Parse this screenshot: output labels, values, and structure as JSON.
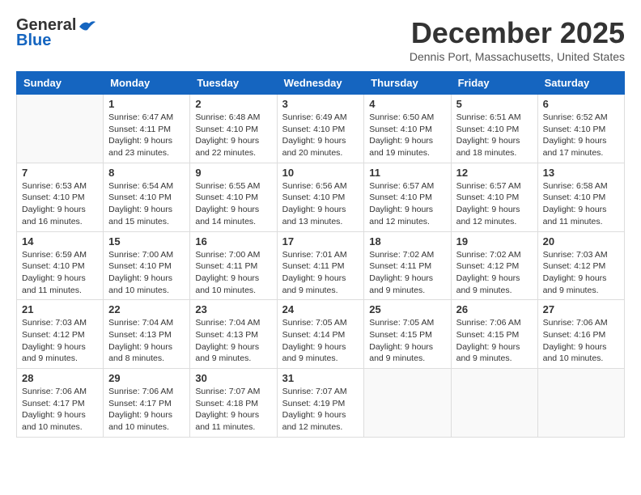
{
  "header": {
    "logo_general": "General",
    "logo_blue": "Blue",
    "month_title": "December 2025",
    "location": "Dennis Port, Massachusetts, United States"
  },
  "days_of_week": [
    "Sunday",
    "Monday",
    "Tuesday",
    "Wednesday",
    "Thursday",
    "Friday",
    "Saturday"
  ],
  "weeks": [
    [
      {
        "day": "",
        "sunrise": "",
        "sunset": "",
        "daylight": ""
      },
      {
        "day": "1",
        "sunrise": "Sunrise: 6:47 AM",
        "sunset": "Sunset: 4:11 PM",
        "daylight": "Daylight: 9 hours and 23 minutes."
      },
      {
        "day": "2",
        "sunrise": "Sunrise: 6:48 AM",
        "sunset": "Sunset: 4:10 PM",
        "daylight": "Daylight: 9 hours and 22 minutes."
      },
      {
        "day": "3",
        "sunrise": "Sunrise: 6:49 AM",
        "sunset": "Sunset: 4:10 PM",
        "daylight": "Daylight: 9 hours and 20 minutes."
      },
      {
        "day": "4",
        "sunrise": "Sunrise: 6:50 AM",
        "sunset": "Sunset: 4:10 PM",
        "daylight": "Daylight: 9 hours and 19 minutes."
      },
      {
        "day": "5",
        "sunrise": "Sunrise: 6:51 AM",
        "sunset": "Sunset: 4:10 PM",
        "daylight": "Daylight: 9 hours and 18 minutes."
      },
      {
        "day": "6",
        "sunrise": "Sunrise: 6:52 AM",
        "sunset": "Sunset: 4:10 PM",
        "daylight": "Daylight: 9 hours and 17 minutes."
      }
    ],
    [
      {
        "day": "7",
        "sunrise": "Sunrise: 6:53 AM",
        "sunset": "Sunset: 4:10 PM",
        "daylight": "Daylight: 9 hours and 16 minutes."
      },
      {
        "day": "8",
        "sunrise": "Sunrise: 6:54 AM",
        "sunset": "Sunset: 4:10 PM",
        "daylight": "Daylight: 9 hours and 15 minutes."
      },
      {
        "day": "9",
        "sunrise": "Sunrise: 6:55 AM",
        "sunset": "Sunset: 4:10 PM",
        "daylight": "Daylight: 9 hours and 14 minutes."
      },
      {
        "day": "10",
        "sunrise": "Sunrise: 6:56 AM",
        "sunset": "Sunset: 4:10 PM",
        "daylight": "Daylight: 9 hours and 13 minutes."
      },
      {
        "day": "11",
        "sunrise": "Sunrise: 6:57 AM",
        "sunset": "Sunset: 4:10 PM",
        "daylight": "Daylight: 9 hours and 12 minutes."
      },
      {
        "day": "12",
        "sunrise": "Sunrise: 6:57 AM",
        "sunset": "Sunset: 4:10 PM",
        "daylight": "Daylight: 9 hours and 12 minutes."
      },
      {
        "day": "13",
        "sunrise": "Sunrise: 6:58 AM",
        "sunset": "Sunset: 4:10 PM",
        "daylight": "Daylight: 9 hours and 11 minutes."
      }
    ],
    [
      {
        "day": "14",
        "sunrise": "Sunrise: 6:59 AM",
        "sunset": "Sunset: 4:10 PM",
        "daylight": "Daylight: 9 hours and 11 minutes."
      },
      {
        "day": "15",
        "sunrise": "Sunrise: 7:00 AM",
        "sunset": "Sunset: 4:10 PM",
        "daylight": "Daylight: 9 hours and 10 minutes."
      },
      {
        "day": "16",
        "sunrise": "Sunrise: 7:00 AM",
        "sunset": "Sunset: 4:11 PM",
        "daylight": "Daylight: 9 hours and 10 minutes."
      },
      {
        "day": "17",
        "sunrise": "Sunrise: 7:01 AM",
        "sunset": "Sunset: 4:11 PM",
        "daylight": "Daylight: 9 hours and 9 minutes."
      },
      {
        "day": "18",
        "sunrise": "Sunrise: 7:02 AM",
        "sunset": "Sunset: 4:11 PM",
        "daylight": "Daylight: 9 hours and 9 minutes."
      },
      {
        "day": "19",
        "sunrise": "Sunrise: 7:02 AM",
        "sunset": "Sunset: 4:12 PM",
        "daylight": "Daylight: 9 hours and 9 minutes."
      },
      {
        "day": "20",
        "sunrise": "Sunrise: 7:03 AM",
        "sunset": "Sunset: 4:12 PM",
        "daylight": "Daylight: 9 hours and 9 minutes."
      }
    ],
    [
      {
        "day": "21",
        "sunrise": "Sunrise: 7:03 AM",
        "sunset": "Sunset: 4:12 PM",
        "daylight": "Daylight: 9 hours and 9 minutes."
      },
      {
        "day": "22",
        "sunrise": "Sunrise: 7:04 AM",
        "sunset": "Sunset: 4:13 PM",
        "daylight": "Daylight: 9 hours and 8 minutes."
      },
      {
        "day": "23",
        "sunrise": "Sunrise: 7:04 AM",
        "sunset": "Sunset: 4:13 PM",
        "daylight": "Daylight: 9 hours and 9 minutes."
      },
      {
        "day": "24",
        "sunrise": "Sunrise: 7:05 AM",
        "sunset": "Sunset: 4:14 PM",
        "daylight": "Daylight: 9 hours and 9 minutes."
      },
      {
        "day": "25",
        "sunrise": "Sunrise: 7:05 AM",
        "sunset": "Sunset: 4:15 PM",
        "daylight": "Daylight: 9 hours and 9 minutes."
      },
      {
        "day": "26",
        "sunrise": "Sunrise: 7:06 AM",
        "sunset": "Sunset: 4:15 PM",
        "daylight": "Daylight: 9 hours and 9 minutes."
      },
      {
        "day": "27",
        "sunrise": "Sunrise: 7:06 AM",
        "sunset": "Sunset: 4:16 PM",
        "daylight": "Daylight: 9 hours and 10 minutes."
      }
    ],
    [
      {
        "day": "28",
        "sunrise": "Sunrise: 7:06 AM",
        "sunset": "Sunset: 4:17 PM",
        "daylight": "Daylight: 9 hours and 10 minutes."
      },
      {
        "day": "29",
        "sunrise": "Sunrise: 7:06 AM",
        "sunset": "Sunset: 4:17 PM",
        "daylight": "Daylight: 9 hours and 10 minutes."
      },
      {
        "day": "30",
        "sunrise": "Sunrise: 7:07 AM",
        "sunset": "Sunset: 4:18 PM",
        "daylight": "Daylight: 9 hours and 11 minutes."
      },
      {
        "day": "31",
        "sunrise": "Sunrise: 7:07 AM",
        "sunset": "Sunset: 4:19 PM",
        "daylight": "Daylight: 9 hours and 12 minutes."
      },
      {
        "day": "",
        "sunrise": "",
        "sunset": "",
        "daylight": ""
      },
      {
        "day": "",
        "sunrise": "",
        "sunset": "",
        "daylight": ""
      },
      {
        "day": "",
        "sunrise": "",
        "sunset": "",
        "daylight": ""
      }
    ]
  ]
}
